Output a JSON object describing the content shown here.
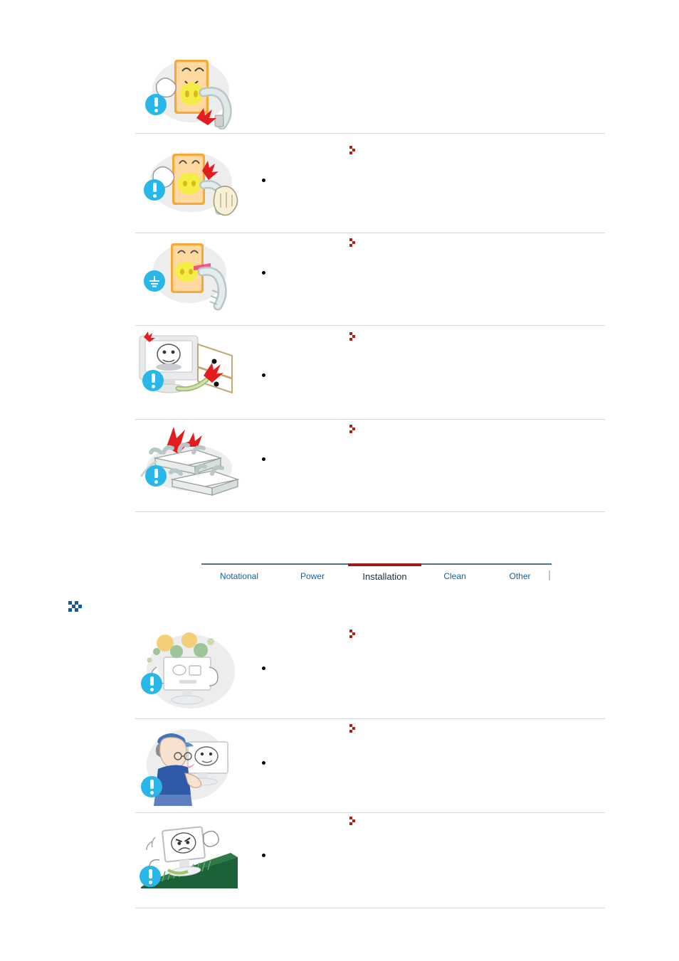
{
  "document": {
    "kind": "safety-instructions-manual-page",
    "background_color": "#ffffff"
  },
  "theme": {
    "badge_blue": "#29b6e8",
    "tab_link_blue": "#1a5f96",
    "tab_active_red": "#9e1b1b",
    "tab_rule_blue": "#4a7491",
    "chevron_red": "#b22018",
    "chevron_blue": "#1459a0",
    "divider_gray": "#d8d8d8"
  },
  "power_section": {
    "items": [
      {
        "id": "power-item-1",
        "illustration": "outlet-character-pulling-plug-with-spark",
        "badge": "exclamation",
        "badge_icon": "exclamation-icon",
        "has_red_chevron": false,
        "heading": "",
        "bullets": []
      },
      {
        "id": "power-item-2",
        "illustration": "outlet-character-with-wet-hand-touching-plug",
        "badge": "exclamation",
        "badge_icon": "exclamation-icon",
        "has_red_chevron": true,
        "heading": "",
        "bullets": [
          ""
        ]
      },
      {
        "id": "power-item-3",
        "illustration": "grounded-outlet-with-plug",
        "badge": "ground",
        "badge_icon": "ground-earth-icon",
        "has_red_chevron": true,
        "heading": "",
        "bullets": [
          ""
        ]
      },
      {
        "id": "power-item-4",
        "illustration": "monitor-with-damaged-power-cord-near-window",
        "badge": "exclamation",
        "badge_icon": "exclamation-icon",
        "has_red_chevron": true,
        "heading": "",
        "bullets": [
          ""
        ]
      },
      {
        "id": "power-item-5",
        "illustration": "overloaded-power-strips-with-sparks",
        "badge": "exclamation",
        "badge_icon": "exclamation-icon",
        "has_red_chevron": true,
        "heading": "",
        "bullets": [
          ""
        ]
      }
    ]
  },
  "tabs": {
    "items": [
      {
        "label": "Notational",
        "active": false
      },
      {
        "label": "Power",
        "active": false
      },
      {
        "label": "Installation",
        "active": true
      },
      {
        "label": "Clean",
        "active": false
      },
      {
        "label": "Other",
        "active": false
      }
    ]
  },
  "installation_section": {
    "chevron_icon": "double-chevron-right-icon",
    "title": "",
    "items": [
      {
        "id": "install-item-1",
        "illustration": "monitor-surrounded-by-dust-and-germs",
        "badge": "exclamation",
        "badge_icon": "exclamation-icon",
        "has_red_chevron": true,
        "heading": "",
        "bullets": [
          ""
        ]
      },
      {
        "id": "install-item-2",
        "illustration": "person-in-cap-carrying-monitor",
        "badge": "exclamation",
        "badge_icon": "exclamation-icon",
        "has_red_chevron": true,
        "heading": "",
        "bullets": [
          ""
        ]
      },
      {
        "id": "install-item-3",
        "illustration": "monitor-sliding-on-unstable-sloped-green-surface",
        "badge": "exclamation",
        "badge_icon": "exclamation-icon",
        "has_red_chevron": true,
        "heading": "",
        "bullets": [
          ""
        ]
      }
    ]
  }
}
